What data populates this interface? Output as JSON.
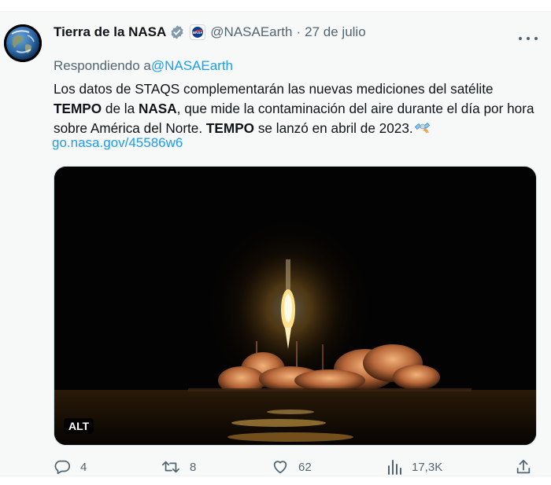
{
  "tweet": {
    "author": {
      "display_name": "Tierra de la NASA",
      "handle": "@NASAEarth",
      "avatar_icon": "earth-globe-avatar",
      "verified_icon": "verified-badge-icon",
      "affiliation_icon": "nasa-logo-icon"
    },
    "separator": "·",
    "date": "27 de julio",
    "reply_prefix": "Respondiendo a",
    "reply_mention": "@NASAEarth",
    "text": {
      "p1": "Los datos de STAQS complementarán las nuevas mediciones del satélite ",
      "b1": "TEMPO",
      "p2": " de la ",
      "b2": "NASA",
      "p3": ", que mide la contaminación del aire durante el día por hora sobre América del Norte. ",
      "b3": "TEMPO",
      "p4": " se lanzó en abril de 2023."
    },
    "emoji_icon": "satellite-emoji-icon",
    "link": "go.nasa.gov/45586w6",
    "media": {
      "alt_badge": "ALT",
      "image": "rocket-launch-night"
    },
    "actions": {
      "replies": "4",
      "retweets": "8",
      "likes": "62",
      "views": "17,3K"
    }
  },
  "colors": {
    "text_primary": "#0f1419",
    "text_secondary": "#536471",
    "link": "#1d9bf0",
    "background": "#f7f9f9"
  }
}
